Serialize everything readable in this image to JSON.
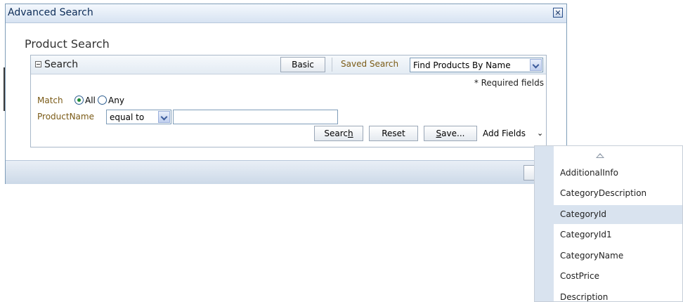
{
  "dialog": {
    "title": "Advanced Search",
    "close_glyph": "✕",
    "page_title": "Product Search"
  },
  "panel": {
    "title": "Search",
    "basic_button": "Basic",
    "saved_search_label": "Saved Search",
    "saved_search_value": "Find Products By Name",
    "required_note": "* Required fields",
    "match_label": "Match",
    "match_options": [
      "All",
      "Any"
    ],
    "match_selected": "All",
    "field_label": "ProductName",
    "operator_value": "equal to",
    "field_value": "",
    "buttons": {
      "search_pre": "Searc",
      "search_ul": "h",
      "reset": "Reset",
      "save_ul": "S",
      "save_post": "ave...",
      "add_fields": "Add Fields",
      "add_fields_chevron": "⌄"
    }
  },
  "add_fields_menu": {
    "items": [
      "AdditionalInfo",
      "CategoryDescription",
      "CategoryId",
      "CategoryId1",
      "CategoryName",
      "CostPrice",
      "Description"
    ],
    "highlighted": "CategoryId"
  },
  "icons": {
    "collapse": "collapse-icon",
    "dropdown": "chevron-down-icon",
    "scroll_up": "scroll-up-icon",
    "close": "close-icon"
  }
}
